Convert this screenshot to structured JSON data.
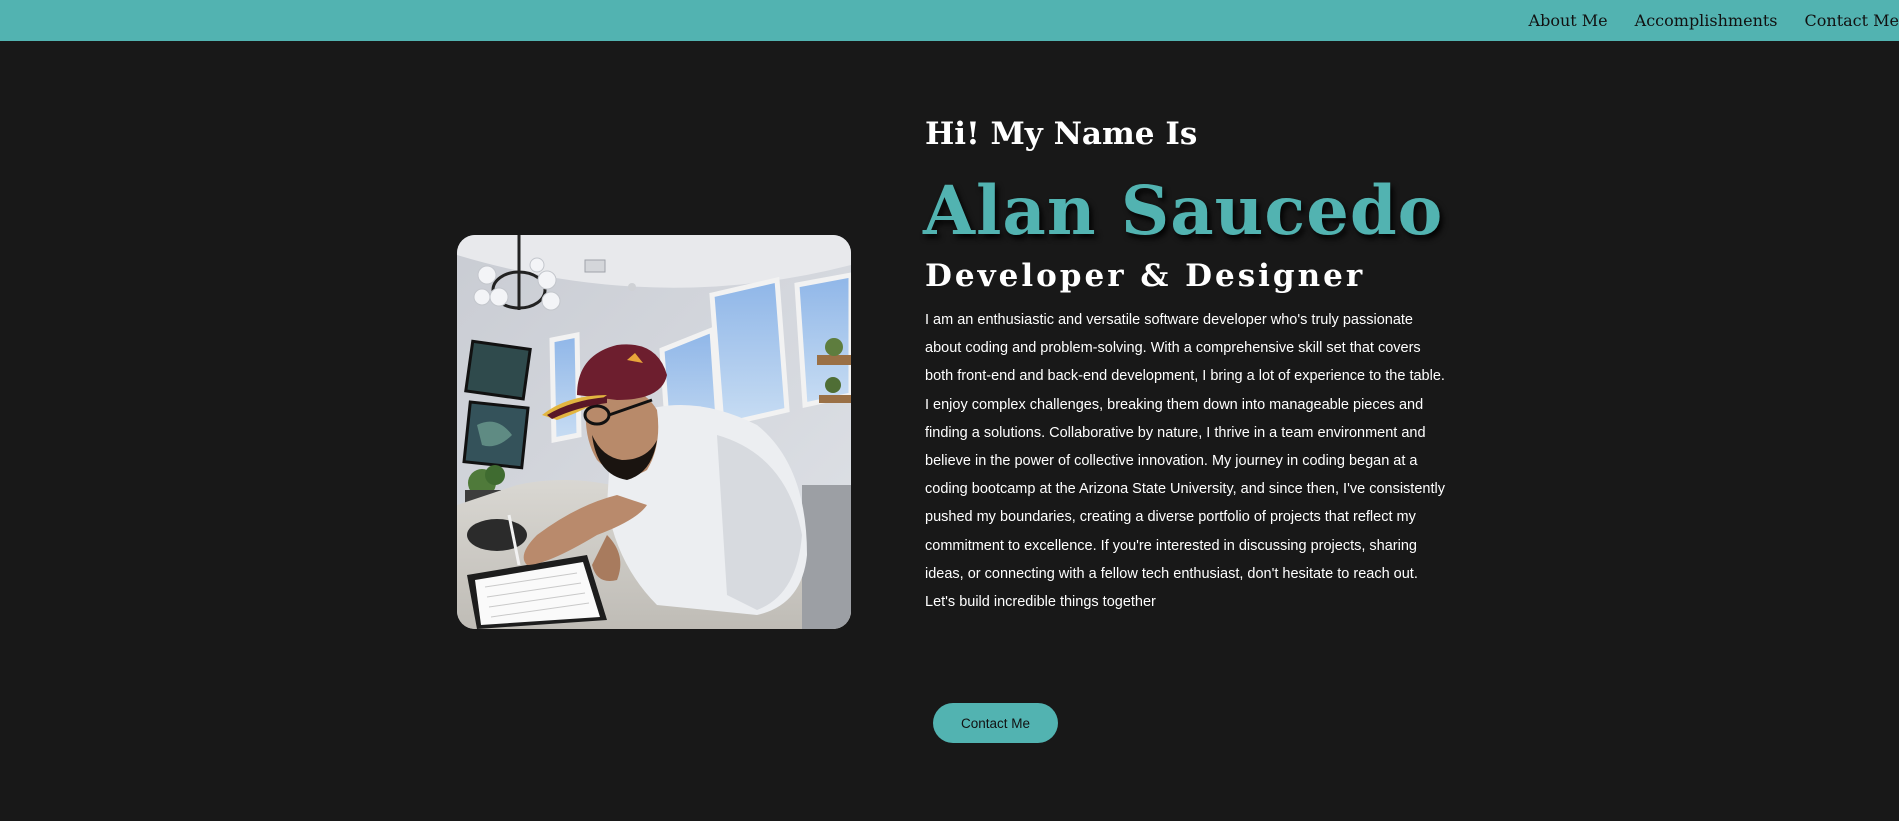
{
  "nav": {
    "items": [
      {
        "label": "About Me"
      },
      {
        "label": "Accomplishments"
      },
      {
        "label": "Contact Me"
      }
    ]
  },
  "hero": {
    "greeting": "Hi! My Name Is",
    "name": "Alan Saucedo",
    "role": "Developer & Designer",
    "bio": "I am an enthusiastic and versatile software developer who's truly passionate about coding and problem-solving. With a comprehensive skill set that covers both front-end and back-end development, I bring a lot of experience to the table. I enjoy complex challenges, breaking them down into manageable pieces and finding a solutions. Collaborative by nature, I thrive in a team environment and believe in the power of collective innovation. My journey in coding began at a coding bootcamp at the Arizona State University, and since then, I've consistently pushed my boundaries, creating a diverse portfolio of projects that reflect my commitment to excellence. If you're interested in discussing projects, sharing ideas, or connecting with a fellow tech enthusiast, don't hesitate to reach out. Let's build incredible things together",
    "cta_label": "Contact Me"
  },
  "colors": {
    "accent": "#52b3b1",
    "background": "#181818",
    "text": "#ffffff"
  }
}
